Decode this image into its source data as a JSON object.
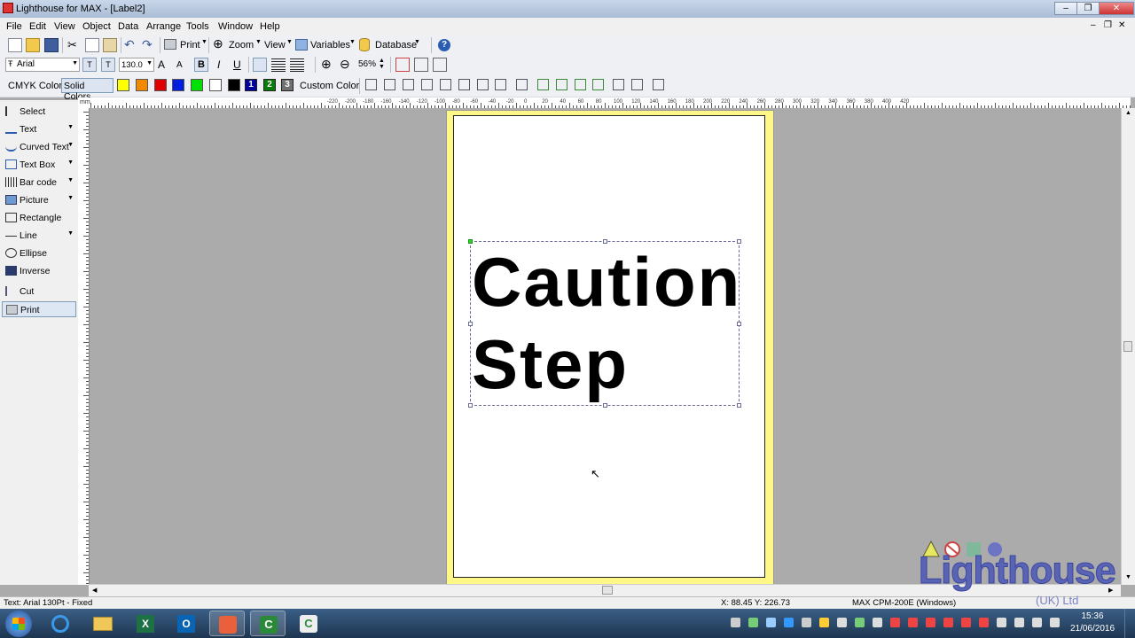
{
  "window": {
    "title": "Lighthouse for MAX - [Label2]",
    "minimize": "–",
    "restore": "❐",
    "close": "✕"
  },
  "menu": [
    "File",
    "Edit",
    "View",
    "Object",
    "Data",
    "Arrange",
    "Tools",
    "Window",
    "Help"
  ],
  "mdi_controls": {
    "minimize": "–",
    "restore": "❐",
    "close": "✕"
  },
  "toolbar1": {
    "print_label": "Print",
    "zoom_label": "Zoom",
    "view_label": "View",
    "variables_label": "Variables",
    "database_label": "Database"
  },
  "toolbar2": {
    "font_name": "Arial",
    "font_size": "130.0",
    "bold": "B",
    "italic": "I",
    "underline": "U",
    "zoom_value": "56%"
  },
  "toolbar3": {
    "cmyk_label": "CMYK Colors",
    "solid_label": "Solid Colors",
    "swatches": [
      "#ffff00",
      "#f28a00",
      "#e00000",
      "#0020e0",
      "#00e000",
      "#ffffff",
      "#000000"
    ],
    "numbered_swatches": [
      {
        "number": "1",
        "color": "#0000a0"
      },
      {
        "number": "2",
        "color": "#0a7a0a"
      },
      {
        "number": "3",
        "color": "#707070"
      }
    ],
    "custom_color_label": "Custom Color"
  },
  "tools": [
    {
      "label": "Select",
      "icon": "cursor-icon",
      "dropdown": false
    },
    {
      "label": "Text",
      "icon": "text-a-icon",
      "dropdown": true
    },
    {
      "label": "Curved Text",
      "icon": "curved-text-icon",
      "dropdown": true
    },
    {
      "label": "Text Box",
      "icon": "text-box-icon",
      "dropdown": true
    },
    {
      "label": "Bar code",
      "icon": "barcode-icon",
      "dropdown": true
    },
    {
      "label": "Picture",
      "icon": "picture-icon",
      "dropdown": true
    },
    {
      "label": "Rectangle",
      "icon": "rectangle-icon",
      "dropdown": false
    },
    {
      "label": "Line",
      "icon": "line-icon",
      "dropdown": true
    },
    {
      "label": "Ellipse",
      "icon": "ellipse-icon",
      "dropdown": false
    },
    {
      "label": "Inverse",
      "icon": "inverse-icon",
      "dropdown": false
    },
    {
      "label": "Cut",
      "icon": "scissors-icon",
      "dropdown": false
    },
    {
      "label": "Print",
      "icon": "printer-icon",
      "dropdown": false
    }
  ],
  "ruler": {
    "unit": "mm",
    "top_labels": [
      "-220",
      "-200",
      "-180",
      "-160",
      "-140",
      "-120",
      "-100",
      "-80",
      "-60",
      "-40",
      "-20",
      "0",
      "20",
      "40",
      "60",
      "80",
      "100",
      "120",
      "140",
      "160",
      "180",
      "200",
      "220",
      "240",
      "260",
      "280",
      "300",
      "320",
      "340",
      "360",
      "380",
      "400",
      "420"
    ]
  },
  "label_text": {
    "line1": "Caution",
    "line2": "Step"
  },
  "status": {
    "left": "Text: Arial 130Pt - Fixed",
    "coords": "X: 88.45 Y: 226.73",
    "printer": "MAX CPM-200E (Windows)"
  },
  "taskbar": {
    "time": "15:36",
    "date": "21/06/2016"
  },
  "watermark": {
    "name": "Lighthouse",
    "suffix": "(UK) Ltd"
  }
}
